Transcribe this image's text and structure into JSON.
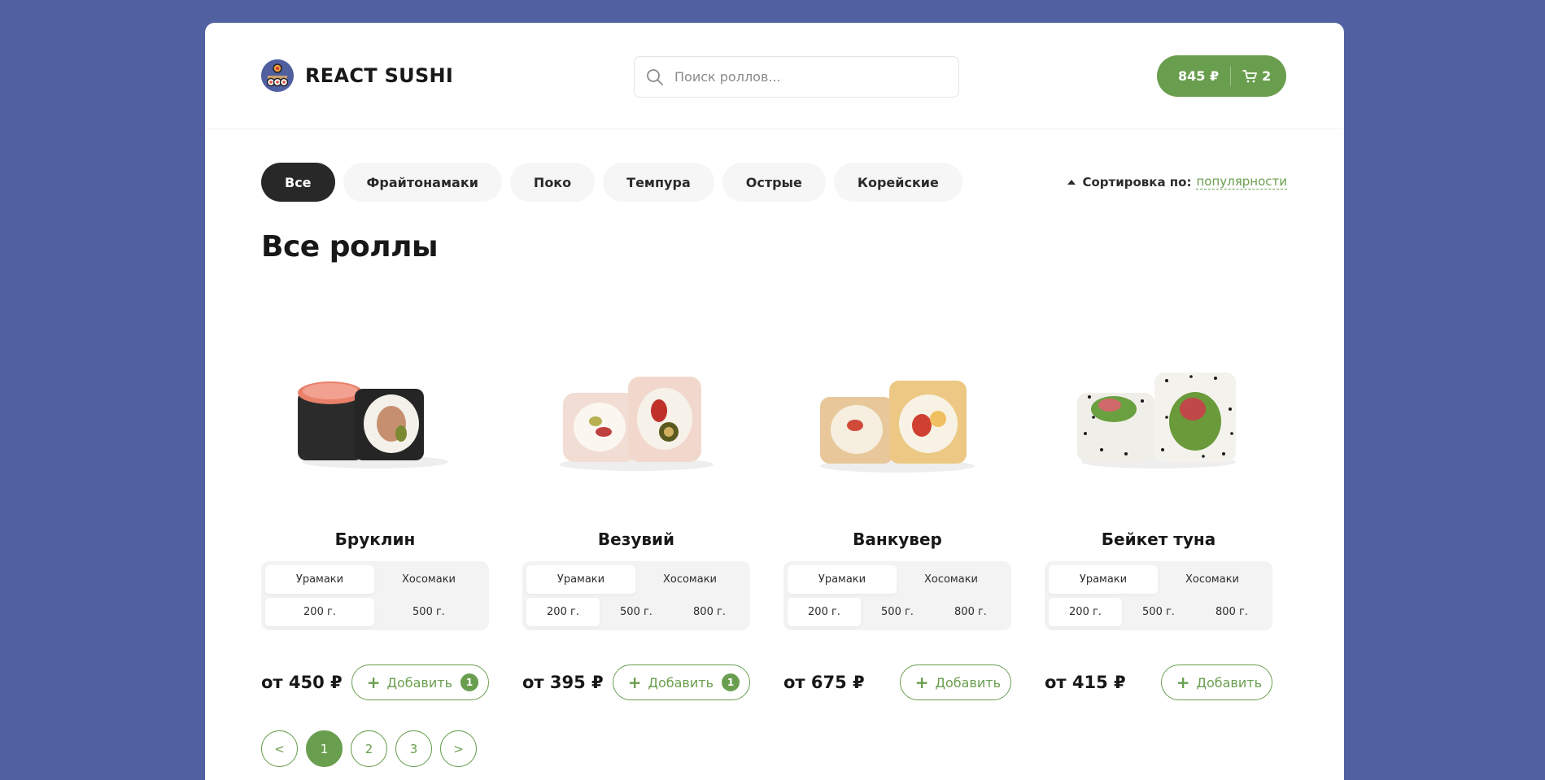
{
  "header": {
    "logo_title": "REACT SUSHI",
    "search_placeholder": "Поиск роллов...",
    "cart_price": "845 ₽",
    "cart_count": "2"
  },
  "categories": [
    "Все",
    "Фрайтонамаки",
    "Поко",
    "Темпура",
    "Острые",
    "Корейские"
  ],
  "active_category": "Все",
  "sort": {
    "label": "Сортировка по:",
    "value": "популярности"
  },
  "page_title": "Все роллы",
  "products": [
    {
      "name": "Бруклин",
      "types": [
        "Урамаки",
        "Хосомаки"
      ],
      "sizes": [
        "200 г.",
        "500 г."
      ],
      "price": "от 450 ₽",
      "add_label": "Добавить",
      "count": "1"
    },
    {
      "name": "Везувий",
      "types": [
        "Урамаки",
        "Хосомаки"
      ],
      "sizes": [
        "200 г.",
        "500 г.",
        "800 г."
      ],
      "price": "от 395 ₽",
      "add_label": "Добавить",
      "count": "1"
    },
    {
      "name": "Ванкувер",
      "types": [
        "Урамаки",
        "Хосомаки"
      ],
      "sizes": [
        "200 г.",
        "500 г.",
        "800 г."
      ],
      "price": "от 675 ₽",
      "add_label": "Добавить",
      "count": ""
    },
    {
      "name": "Бейкет туна",
      "types": [
        "Урамаки",
        "Хосомаки"
      ],
      "sizes": [
        "200 г.",
        "500 г.",
        "800 г."
      ],
      "price": "от 415 ₽",
      "add_label": "Добавить",
      "count": ""
    }
  ],
  "pagination": [
    "<",
    "1",
    "2",
    "3",
    ">"
  ],
  "active_page": "1",
  "colors": {
    "background": "#5060a0",
    "accent": "#6a9e4f",
    "dark": "#282828"
  }
}
